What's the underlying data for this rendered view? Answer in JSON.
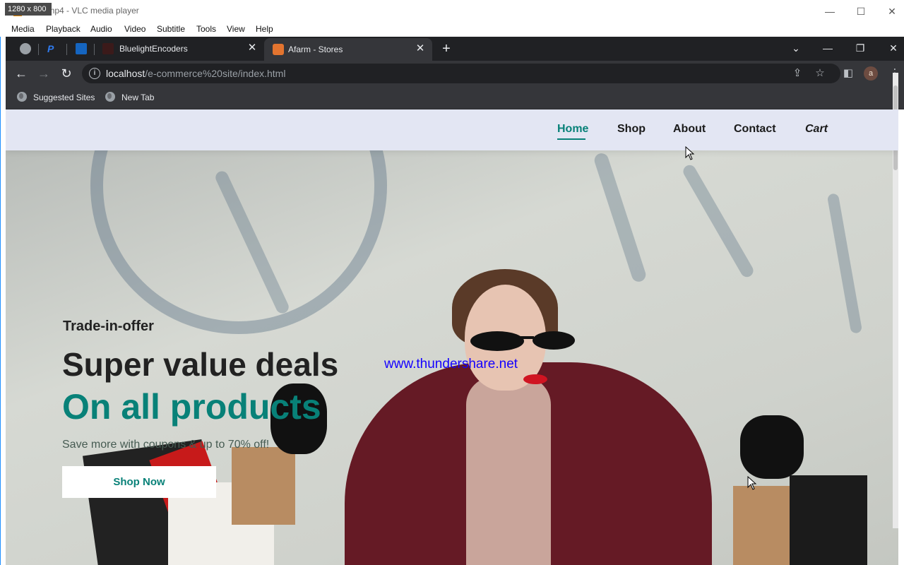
{
  "vlc": {
    "size_badge": "1280 x 800",
    "title": "shop.mp4 - VLC media player",
    "menu": [
      "Media",
      "Playback",
      "Audio",
      "Video",
      "Subtitle",
      "Tools",
      "View",
      "Help"
    ]
  },
  "browser": {
    "tabs": [
      {
        "label": "BluelightEncoders",
        "close": "✕"
      },
      {
        "label": "Afarm - Stores",
        "close": "✕",
        "active": true
      }
    ],
    "new_tab": "+",
    "url_host": "localhost",
    "url_path": "/e-commerce%20site/index.html",
    "avatar_letter": "a",
    "bookmarks": [
      "Suggested Sites",
      "New Tab"
    ]
  },
  "site": {
    "nav": [
      "Home",
      "Shop",
      "About",
      "Contact",
      "Cart"
    ],
    "hero": {
      "eyebrow": "Trade-in-offer",
      "headline": "Super value deals",
      "headline_accent": "On all products",
      "subtext": "Save more with coupons & up to 70% off!",
      "cta": "Shop Now"
    },
    "watermark": "www.thundershare.net"
  },
  "colors": {
    "accent": "#088178",
    "nav_bg": "#e3e6f3",
    "tabstrip": "#202124",
    "toolbar": "#35363a",
    "watermark": "#1400ff"
  }
}
